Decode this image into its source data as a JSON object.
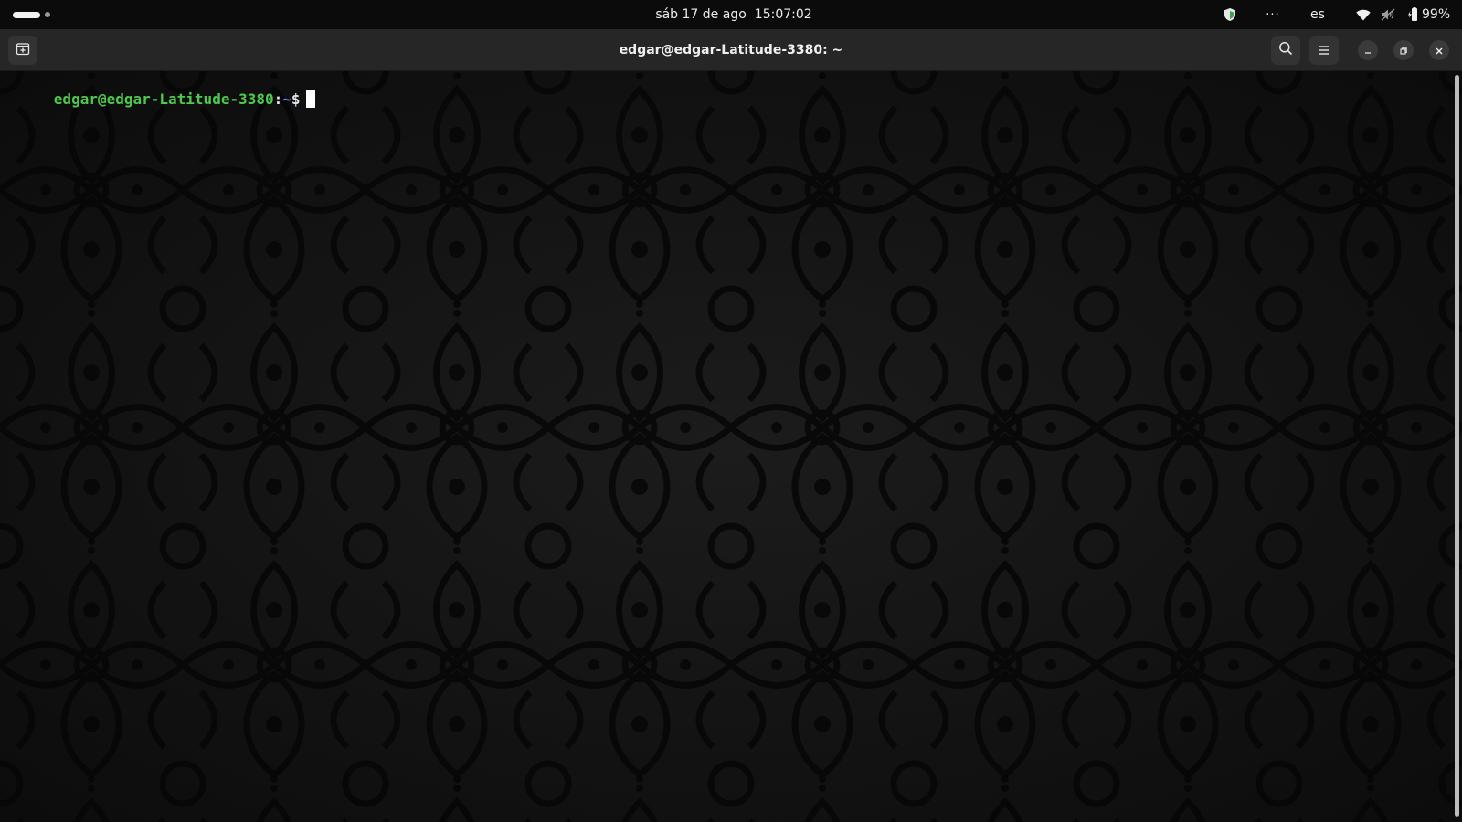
{
  "topbar": {
    "date": "sáb 17 de ago",
    "time": "15:07:02",
    "overflow": "···",
    "language": "es",
    "battery": "99%",
    "icons": {
      "shield": "shield-icon",
      "wifi": "wifi-icon",
      "volume": "volume-muted-icon",
      "battery": "battery-charging-icon"
    }
  },
  "window": {
    "title": "edgar@edgar-Latitude-3380: ~",
    "new_tab_icon": "new-tab-icon",
    "search_icon": "search-icon",
    "menu_icon": "hamburger-menu-icon",
    "minimize_icon": "minimize-icon",
    "maximize_icon": "restore-icon",
    "close_icon": "close-icon"
  },
  "terminal": {
    "prompt_user": "edgar@edgar-Latitude-3380",
    "prompt_colon": ":",
    "prompt_path": "~",
    "prompt_symbol": "$",
    "colors": {
      "user": "#4ec94e",
      "path": "#5b8fe8",
      "text": "#e6e6e6",
      "background": "#111111"
    }
  }
}
